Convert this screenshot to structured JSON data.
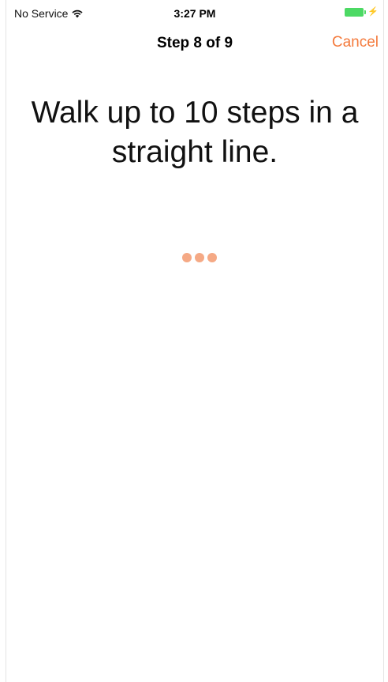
{
  "status_bar": {
    "carrier": "No Service",
    "time": "3:27 PM",
    "battery_color": "#4cd964"
  },
  "nav": {
    "title": "Step 8 of 9",
    "cancel_label": "Cancel",
    "accent_color": "#f47a3c"
  },
  "main": {
    "instruction": "Walk up to 10 steps in a straight line.",
    "activity_indicator": "three-dots-icon"
  }
}
